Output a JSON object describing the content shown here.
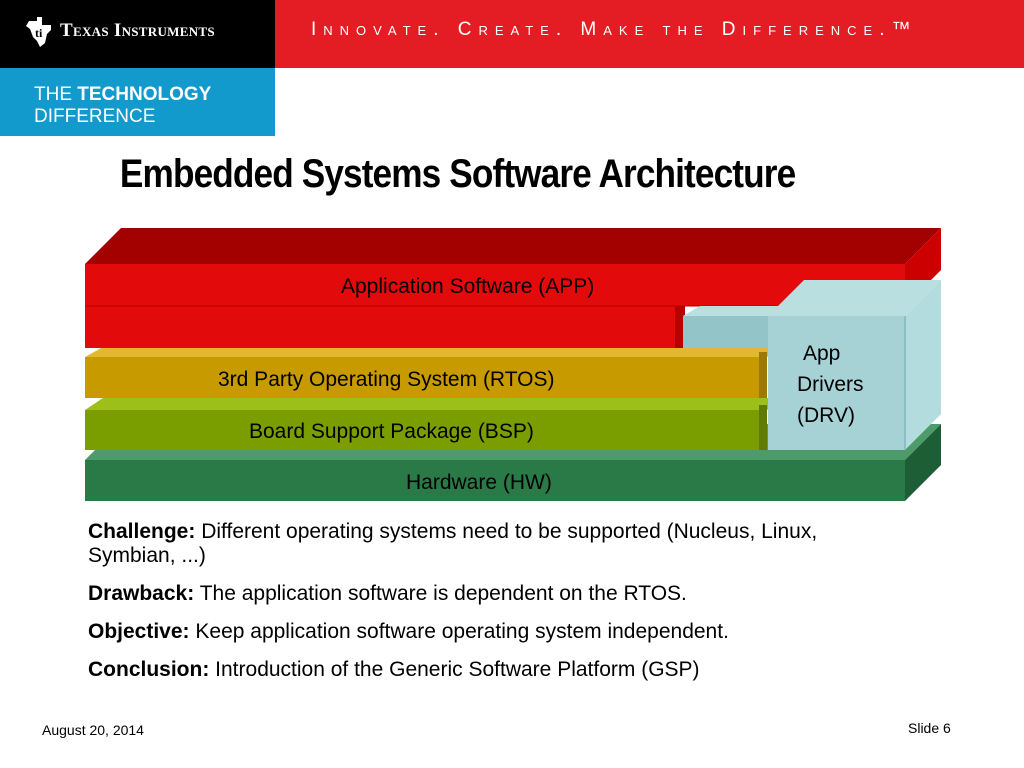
{
  "header": {
    "company": "Texas Instruments",
    "slogan": "Innovate. Create. Make the Difference.™",
    "tech_line1_a": "THE",
    "tech_line1_b": "TECHNOLOGY",
    "tech_line2": "DIFFERENCE"
  },
  "title": "Embedded Systems Software Architecture",
  "diagram": {
    "layers": {
      "app": "Application Software (APP)",
      "rtos": "3rd Party Operating System (RTOS)",
      "bsp": "Board Support Package (BSP)",
      "hw": "Hardware (HW)",
      "drv_line1": "App",
      "drv_line2": "Drivers",
      "drv_line3": "(DRV)"
    },
    "colors": {
      "app": "#e20a0a",
      "rtos": "#c79a00",
      "bsp": "#7a9e00",
      "hw": "#2a7a48",
      "drv": "#a7d2d5"
    }
  },
  "points": [
    {
      "label": "Challenge:",
      "text": "Different operating systems need to be supported (Nucleus, Linux, Symbian, ...)"
    },
    {
      "label": "Drawback:",
      "text": "The application software is dependent on the RTOS."
    },
    {
      "label": "Objective:",
      "text": "Keep application software operating system independent."
    },
    {
      "label": "Conclusion:",
      "text": "Introduction of the Generic Software Platform (GSP)"
    }
  ],
  "footer": {
    "date": "August 20, 2014",
    "slide": "Slide 6"
  }
}
